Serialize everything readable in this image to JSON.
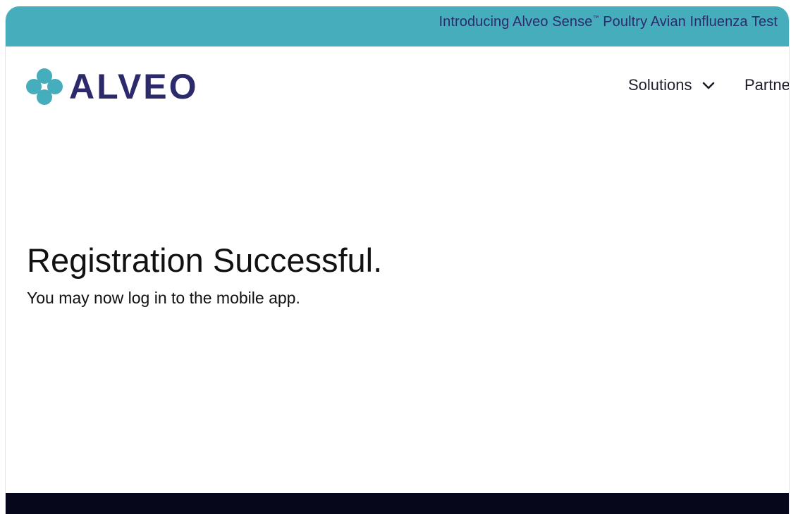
{
  "announcement": {
    "text_before": "Introducing Alveo Sense",
    "trademark": "™",
    "text_after": " Poultry Avian Influenza Test"
  },
  "logo": {
    "wordmark": "ALVEO",
    "icon": "four-dots-logo-icon"
  },
  "nav": {
    "items": [
      {
        "label": "Solutions",
        "icon": "chevron-down-icon"
      },
      {
        "label": "Partne"
      }
    ]
  },
  "main": {
    "title": "Registration Successful.",
    "message": "You may now log in to the mobile app."
  },
  "colors": {
    "announcement_bg": "#46adbd",
    "brand_navy": "#2c2a6b",
    "logo_teal": "#46adbd",
    "footer_bg": "#06071a"
  }
}
